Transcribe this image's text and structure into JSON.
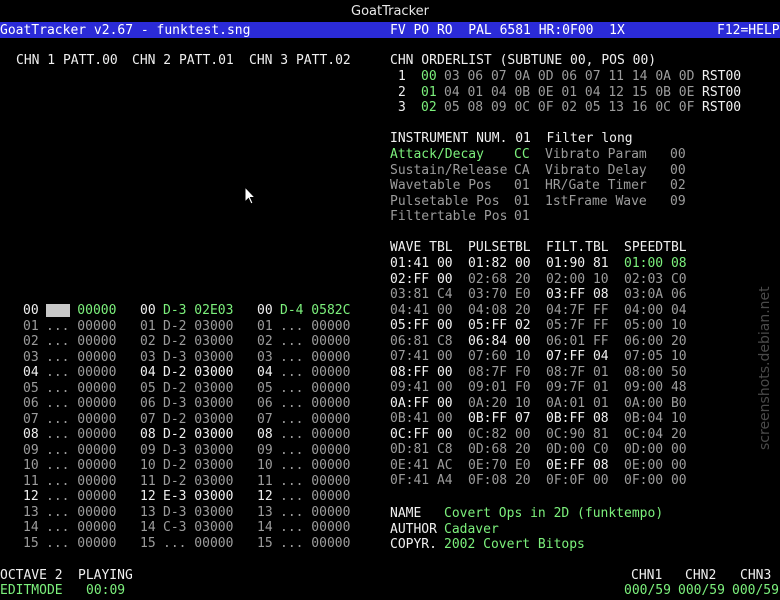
{
  "window": {
    "title": "GoatTracker"
  },
  "menubar": {
    "left": "GoatTracker v2.67 - funktest.sng",
    "flags": "FV PO RO  PAL 6581 HR:0F00  1X",
    "help": "F12=HELP"
  },
  "patterns": {
    "headers": [
      "CHN 1 PATT.00",
      "CHN 2 PATT.01",
      "CHN 3 PATT.02"
    ],
    "rows": [
      {
        "n": "00",
        "c1": "... 00000",
        "c2": "D-3 02E03",
        "c3": "D-4 0582C"
      },
      {
        "n": "01",
        "c1": "... 00000",
        "c2": "D-2 03000",
        "c3": "... 00000"
      },
      {
        "n": "02",
        "c1": "... 00000",
        "c2": "D-2 03000",
        "c3": "... 00000"
      },
      {
        "n": "03",
        "c1": "... 00000",
        "c2": "D-3 03000",
        "c3": "... 00000"
      },
      {
        "n": "04",
        "c1": "... 00000",
        "c2": "D-2 03000",
        "c3": "... 00000"
      },
      {
        "n": "05",
        "c1": "... 00000",
        "c2": "D-2 03000",
        "c3": "... 00000"
      },
      {
        "n": "06",
        "c1": "... 00000",
        "c2": "D-3 03000",
        "c3": "... 00000"
      },
      {
        "n": "07",
        "c1": "... 00000",
        "c2": "D-2 03000",
        "c3": "... 00000"
      },
      {
        "n": "08",
        "c1": "... 00000",
        "c2": "D-2 03000",
        "c3": "... 00000"
      },
      {
        "n": "09",
        "c1": "... 00000",
        "c2": "D-3 03000",
        "c3": "... 00000"
      },
      {
        "n": "10",
        "c1": "... 00000",
        "c2": "D-2 03000",
        "c3": "... 00000"
      },
      {
        "n": "11",
        "c1": "... 00000",
        "c2": "D-2 03000",
        "c3": "... 00000"
      },
      {
        "n": "12",
        "c1": "... 00000",
        "c2": "E-3 03000",
        "c3": "... 00000"
      },
      {
        "n": "13",
        "c1": "... 00000",
        "c2": "D-3 03000",
        "c3": "... 00000"
      },
      {
        "n": "14",
        "c1": "... 00000",
        "c2": "C-3 03000",
        "c3": "... 00000"
      },
      {
        "n": "15",
        "c1": "... 00000",
        "c2": "... 00000",
        "c3": "... 00000"
      }
    ]
  },
  "orderlist": {
    "header": "CHN ORDERLIST (SUBTUNE 00, POS 00)",
    "rows": [
      {
        "n": "1",
        "first": "00",
        "rest": "03 06 07 0A 0D 06 07 11 14 0A 0D",
        "end": "RST00"
      },
      {
        "n": "2",
        "first": "01",
        "rest": "04 01 04 0B 0E 01 04 12 15 0B 0E",
        "end": "RST00"
      },
      {
        "n": "3",
        "first": "02",
        "rest": "05 08 09 0C 0F 02 05 13 16 0C 0F",
        "end": "RST00"
      }
    ]
  },
  "instrument": {
    "header": "INSTRUMENT NUM. 01  Filter long",
    "params": [
      {
        "l1": "Attack/Decay    ",
        "v1": "CC",
        "l2": "Vibrato Param   ",
        "v2": "00"
      },
      {
        "l1": "Sustain/Release ",
        "v1": "CA",
        "l2": "Vibrato Delay   ",
        "v2": "00"
      },
      {
        "l1": "Wavetable Pos   ",
        "v1": "01",
        "l2": "HR/Gate Timer   ",
        "v2": "02"
      },
      {
        "l1": "Pulsetable Pos  ",
        "v1": "01",
        "l2": "1stFrame Wave   ",
        "v2": "09"
      },
      {
        "l1": "Filtertable Pos ",
        "v1": "01",
        "l2": "",
        "v2": ""
      }
    ]
  },
  "tables": {
    "headers": [
      "WAVE TBL",
      "PULSETBL",
      "FILT.TBL",
      "SPEEDTBL"
    ],
    "rows": [
      [
        "01:41 00",
        "01:82 00",
        "01:90 81",
        "01:00 08"
      ],
      [
        "02:FF 00",
        "02:68 20",
        "02:00 10",
        "02:03 C0"
      ],
      [
        "03:81 C4",
        "03:70 E0",
        "03:FF 08",
        "03:0A 06"
      ],
      [
        "04:41 00",
        "04:08 20",
        "04:7F FF",
        "04:00 04"
      ],
      [
        "05:FF 00",
        "05:FF 02",
        "05:7F FF",
        "05:00 10"
      ],
      [
        "06:81 C8",
        "06:84 00",
        "06:01 FF",
        "06:00 20"
      ],
      [
        "07:41 00",
        "07:60 10",
        "07:FF 04",
        "07:05 10"
      ],
      [
        "08:FF 00",
        "08:7F F0",
        "08:7F 01",
        "08:00 50"
      ],
      [
        "09:41 00",
        "09:01 F0",
        "09:7F 01",
        "09:00 48"
      ],
      [
        "0A:FF 00",
        "0A:20 10",
        "0A:01 01",
        "0A:00 B0"
      ],
      [
        "0B:41 00",
        "0B:FF 07",
        "0B:FF 08",
        "0B:04 10"
      ],
      [
        "0C:FF 00",
        "0C:82 00",
        "0C:90 81",
        "0C:04 20"
      ],
      [
        "0D:81 C8",
        "0D:68 20",
        "0D:00 C0",
        "0D:00 00"
      ],
      [
        "0E:41 AC",
        "0E:70 E0",
        "0E:FF 08",
        "0E:00 00"
      ],
      [
        "0F:41 A4",
        "0F:08 20",
        "0F:0F 00",
        "0F:00 00"
      ]
    ]
  },
  "song": {
    "name_label": "NAME  ",
    "name": "Covert Ops in 2D (funktempo)",
    "author_label": "AUTHOR",
    "author": "Cadaver",
    "copyr_label": "COPYR.",
    "copyr": "2002 Covert Bitops"
  },
  "status": {
    "octave": "OCTAVE 2",
    "playing": "PLAYING",
    "editmode": "EDITMODE",
    "time": "00:09",
    "chn_labels": [
      "CHN1",
      "CHN2",
      "CHN3"
    ],
    "chn_values": [
      "000/59",
      "000/59",
      "000/59"
    ]
  },
  "watermark": "screenshots.debian.net",
  "colors": {
    "background": "#000000",
    "menubar": "#2b2bd8",
    "highlight": "#7cf07c",
    "text": "#9c9c9c",
    "bright": "#f0f0f0"
  }
}
